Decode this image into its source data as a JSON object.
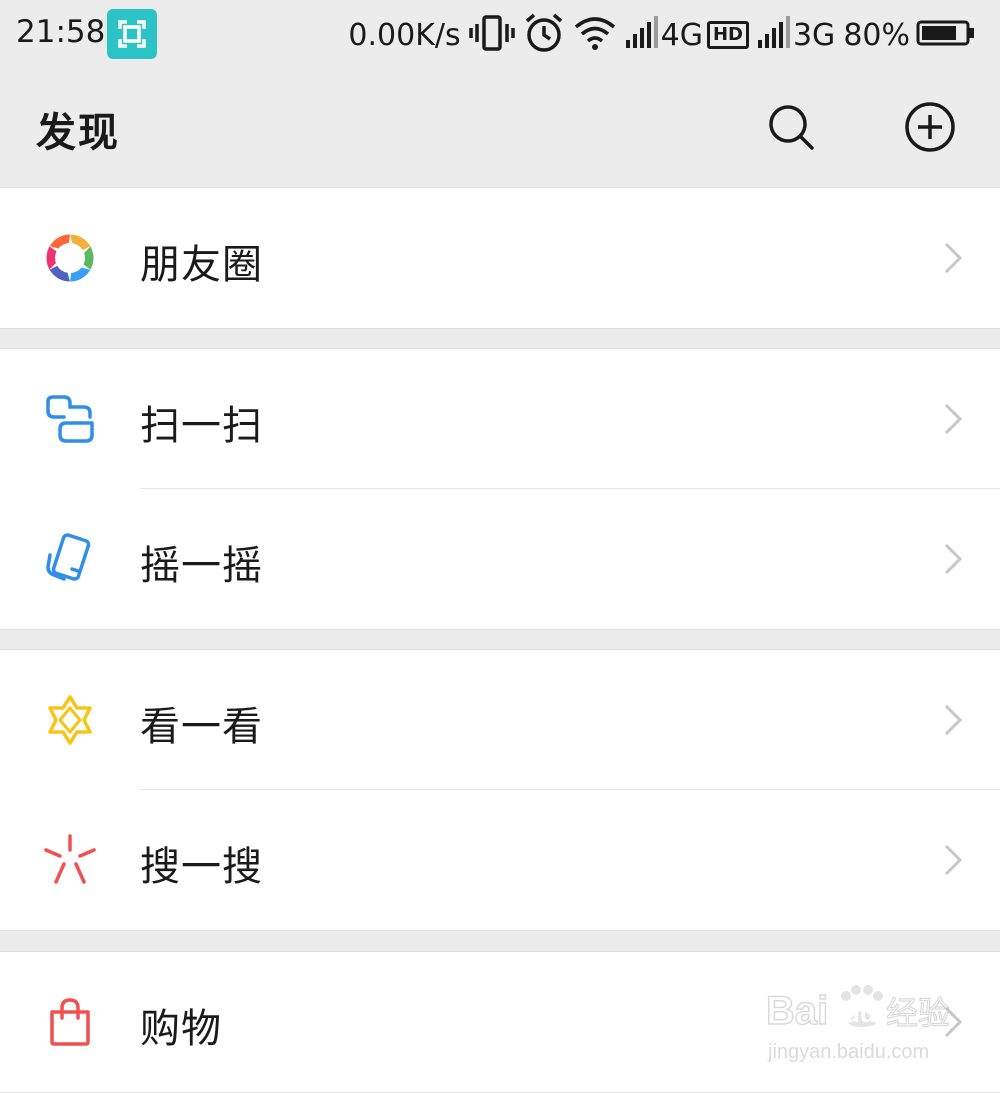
{
  "status_bar": {
    "time": "21:58",
    "net_speed": "0.00K/s",
    "network_1": "4G",
    "hd_badge": "HD",
    "network_2": "3G",
    "battery_percent": "80%",
    "icons": [
      "screenshot-icon",
      "vibrate-icon",
      "alarm-icon",
      "wifi-icon",
      "signal-icon",
      "battery-icon"
    ]
  },
  "header": {
    "title": "发现",
    "icons": [
      "search-icon",
      "add-circle-icon"
    ]
  },
  "menu": {
    "moments": "朋友圈",
    "scan": "扫一扫",
    "shake": "摇一摇",
    "top_stories": "看一看",
    "search": "搜一搜",
    "shopping": "购物"
  },
  "watermark": {
    "brand": "Bai",
    "brand2": "du",
    "cn": "经验",
    "url": "jingyan.baidu.com"
  },
  "colors": {
    "background": "#ececec",
    "card": "#ffffff",
    "scan_blue": "#2f8fe6",
    "top_stories_yellow": "#f5c518",
    "search_red": "#f05050",
    "shopping_red": "#f05050",
    "screenshot_teal": "#2cc3c6"
  }
}
